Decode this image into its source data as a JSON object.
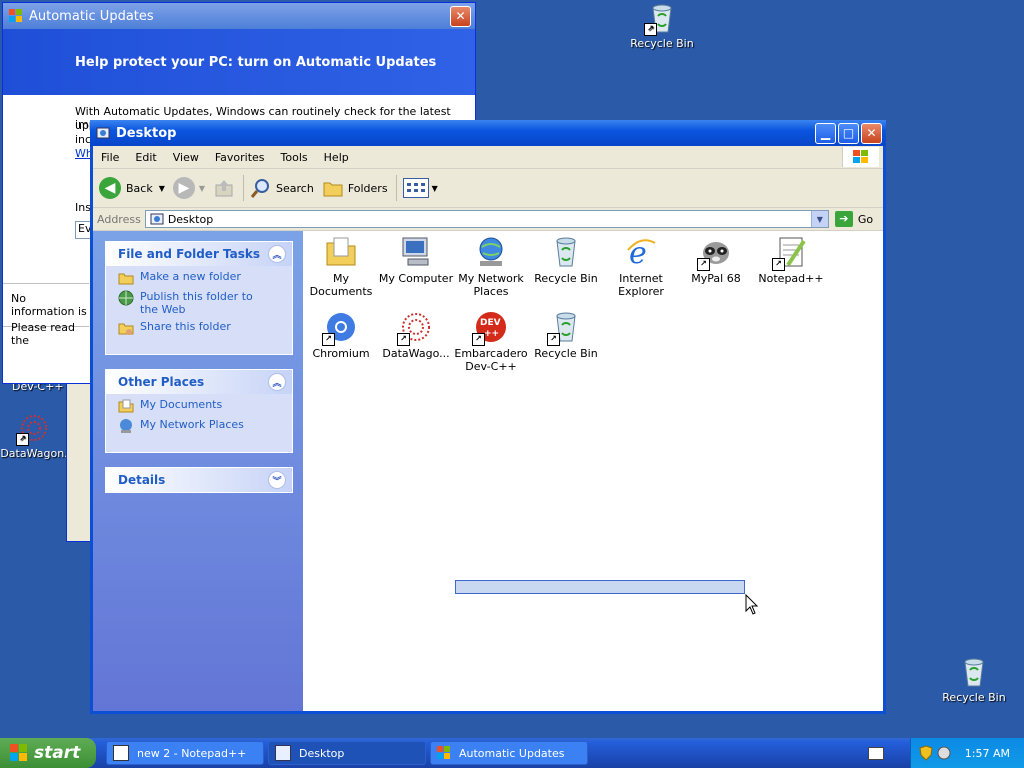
{
  "desktop": {
    "icons": [
      {
        "label": "Recycle Bin"
      },
      {
        "label": "Recycle Bin"
      },
      {
        "label": "DataWagon."
      },
      {
        "label": "Dev-C++"
      }
    ]
  },
  "automatic_updates": {
    "title": "Automatic Updates",
    "header": "Help protect your PC: turn on Automatic Updates",
    "body_line1": "With Automatic Updates, Windows can routinely check for the latest important",
    "frag_up": "up",
    "frag_inc": "inc",
    "frag_wh": "Wh",
    "frag_ins": "Ins",
    "frag_ev": "Ev",
    "info_line1": "No information is",
    "info_line2": "Please read the"
  },
  "explorer": {
    "title": "Desktop",
    "menu": [
      "File",
      "Edit",
      "View",
      "Favorites",
      "Tools",
      "Help"
    ],
    "toolbar": {
      "back": "Back",
      "search": "Search",
      "folders": "Folders"
    },
    "address": {
      "label": "Address",
      "value": "Desktop",
      "go": "Go"
    },
    "file_tasks": {
      "title": "File and Folder Tasks",
      "items": [
        "Make a new folder",
        "Publish this folder to the Web",
        "Share this folder"
      ]
    },
    "other_places": {
      "title": "Other Places",
      "items": [
        "My Documents",
        "My Network Places"
      ]
    },
    "details": {
      "title": "Details"
    },
    "items": [
      {
        "label": "My Documents"
      },
      {
        "label": "My Computer"
      },
      {
        "label": "My Network Places"
      },
      {
        "label": "Recycle Bin"
      },
      {
        "label": "Internet Explorer"
      },
      {
        "label": "MyPal 68"
      },
      {
        "label": "Notepad++"
      },
      {
        "label": "Chromium"
      },
      {
        "label": "DataWago..."
      },
      {
        "label": "Embarcadero Dev-C++"
      },
      {
        "label": "Recycle Bin"
      }
    ]
  },
  "taskbar": {
    "start": "start",
    "buttons": [
      {
        "label": "new 2 - Notepad++"
      },
      {
        "label": "Desktop"
      },
      {
        "label": "Automatic Updates"
      }
    ],
    "clock": "1:57 AM"
  },
  "colors": {
    "accent": "#0a55df",
    "desktop": "#2a5aa8",
    "taskbar": "#245edb",
    "start": "#3c8f34"
  }
}
